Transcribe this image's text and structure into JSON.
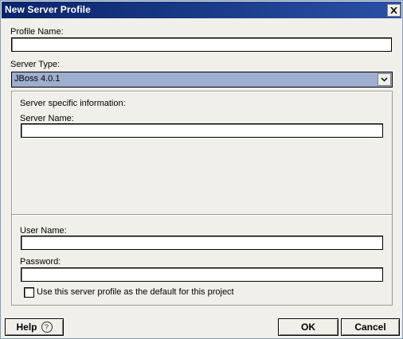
{
  "window": {
    "title": "New Server Profile"
  },
  "form": {
    "profile_name_label": "Profile Name:",
    "profile_name_value": "",
    "server_type_label": "Server Type:",
    "server_type_value": "JBoss 4.0.1",
    "server_info_heading": "Server specific information:",
    "server_name_label": "Server Name:",
    "server_name_value": "",
    "user_name_label": "User Name:",
    "user_name_value": "",
    "password_label": "Password:",
    "password_value": "",
    "default_checkbox_label": "Use this server profile as the default for this project",
    "default_checked": false
  },
  "buttons": {
    "help": "Help",
    "ok": "OK",
    "cancel": "Cancel"
  },
  "icons": {
    "close": "close-icon",
    "dropdown": "chevron-down-icon",
    "help": "question-circle-icon"
  },
  "colors": {
    "titlebar": "#0a246a",
    "select_highlight": "#9eaed1",
    "dialog_bg": "#f1efe9"
  }
}
